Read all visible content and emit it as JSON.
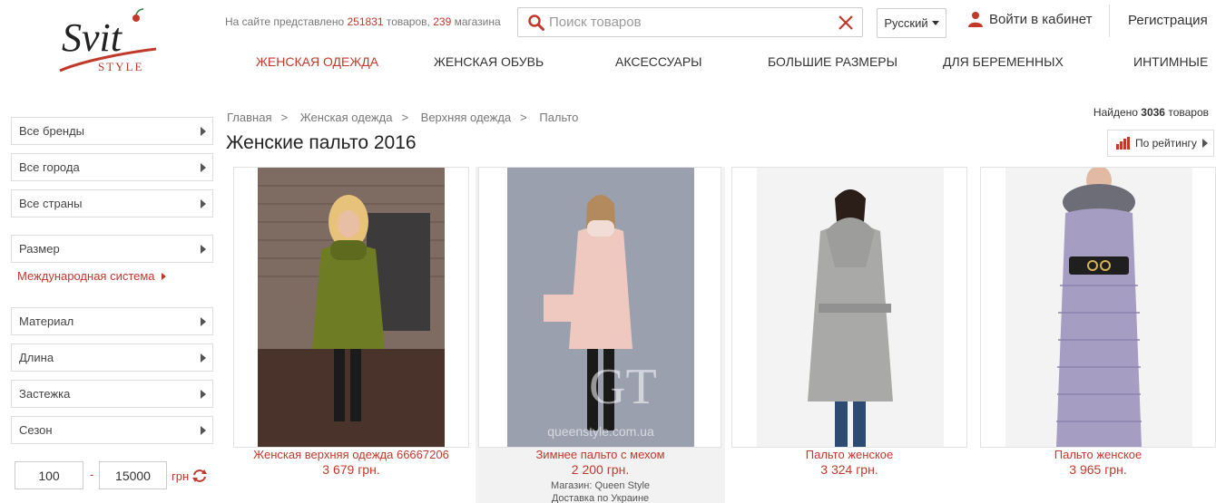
{
  "logo": {
    "word": "Svit",
    "sub": "STYLE"
  },
  "header": {
    "stats_prefix": "На сайте представлено",
    "stats_products_count": "251831",
    "stats_products_label": "товаров,",
    "stats_shops_count": "239",
    "stats_shops_label": "магазина",
    "search_placeholder": "Поиск товаров",
    "language": "Русский",
    "login": "Войти в кабинет",
    "register": "Регистрация"
  },
  "nav": [
    {
      "label": "ЖЕНСКАЯ ОДЕЖДА",
      "active": true
    },
    {
      "label": "ЖЕНСКАЯ ОБУВЬ"
    },
    {
      "label": "АКСЕССУАРЫ"
    },
    {
      "label": "БОЛЬШИЕ РАЗМЕРЫ"
    },
    {
      "label": "ДЛЯ БЕРЕМЕННЫХ"
    },
    {
      "label": "ИНТИМНЫЕ"
    }
  ],
  "sidebar": {
    "filters": [
      "Все бренды",
      "Все города",
      "Все страны",
      "Размер",
      "Материал",
      "Длина",
      "Застежка",
      "Сезон"
    ],
    "size_system": "Международная система",
    "price_min": "100",
    "price_dash": "-",
    "price_max": "15000",
    "currency": "грн"
  },
  "breadcrumb": [
    "Главная",
    "Женская одежда",
    "Верхняя одежда",
    "Пальто"
  ],
  "breadcrumb_sep": ">",
  "found": {
    "prefix": "Найдено",
    "count": "3036",
    "suffix": "товаров"
  },
  "page_title": "Женские пальто 2016",
  "sort_label": "По рейтингу",
  "products": [
    {
      "name": "Женская верхняя одежда 66667206",
      "price": "3 679 грн."
    },
    {
      "name": "Зимнее пальто с мехом",
      "price": "2 200 грн.",
      "shop": "Магазин: Queen Style",
      "delivery": "Доставка по Украине",
      "watermark": "queenstyle.com.ua",
      "watermark_logo": "GT"
    },
    {
      "name": "Пальто женское",
      "price": "3 324 грн."
    },
    {
      "name": "Пальто женское",
      "price": "3 965 грн."
    }
  ],
  "colors": {
    "accent": "#c0392b",
    "border": "#dddddd"
  },
  "icons": [
    "search-icon",
    "clear-icon",
    "user-icon",
    "bar-chart-icon",
    "refresh-icon"
  ]
}
